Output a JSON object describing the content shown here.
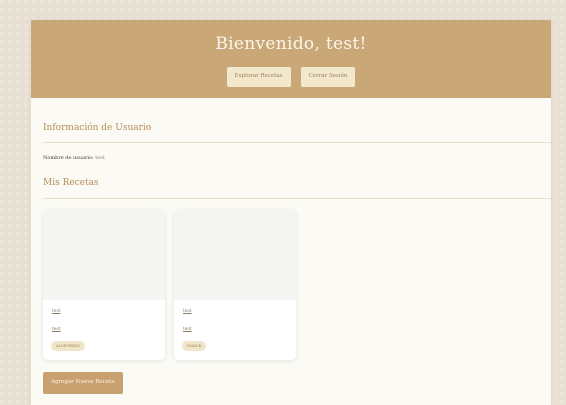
{
  "header": {
    "title": "Bienvenido, test!",
    "explore_label": "Explorar Recetas",
    "logout_label": "Cerrar Sesión"
  },
  "user_info": {
    "section_title": "Información de Usuario",
    "username_label": "Nombre de usuario:",
    "username_value": "test"
  },
  "recipes": {
    "section_title": "Mis Recetas",
    "cards": [
      {
        "title": "test",
        "description": "test",
        "category": "ALMUERZO"
      },
      {
        "title": "test",
        "description": "test",
        "category": "SNACK"
      }
    ],
    "add_label": "Agregar Nueva Receta"
  },
  "colors": {
    "header_bg": "#c9a777",
    "accent": "#b68d57",
    "page_bg": "#fbfaf5",
    "badge_bg": "#f1e5c9"
  }
}
